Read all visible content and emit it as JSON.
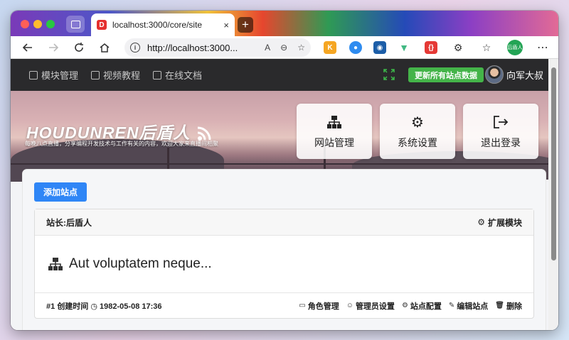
{
  "browser": {
    "tab": {
      "favicon": "D",
      "title": "localhost:3000/core/site",
      "close": "×"
    },
    "new_tab": "+",
    "address": {
      "url": "http://localhost:3000..."
    },
    "profile_label": "后盾人"
  },
  "navbar": {
    "items": [
      {
        "label": "模块管理"
      },
      {
        "label": "视频教程"
      },
      {
        "label": "在线文档"
      }
    ],
    "sync_button": "更新所有站点数据",
    "user_name": "向军大叔"
  },
  "banner": {
    "logo": "HOUDUNREN后盾人",
    "subtitle": "每晚八点直播，分享编程开发技术与工作有关的内容，欢迎大家来直播间相聚",
    "quick_links": [
      {
        "label": "网站管理",
        "icon": "sitemap-icon"
      },
      {
        "label": "系统设置",
        "icon": "gear-icon"
      },
      {
        "label": "退出登录",
        "icon": "logout-icon"
      }
    ]
  },
  "main": {
    "add_button": "添加站点",
    "site": {
      "owner": "站长:后盾人",
      "extend_modules": "扩展模块",
      "name": "Aut voluptatem neque...",
      "id_label": "#1",
      "created_label": "创建时间",
      "created_at": "1982-05-08 17:36",
      "actions": [
        {
          "label": "角色管理",
          "icon": "role-icon"
        },
        {
          "label": "管理员设置",
          "icon": "user-icon"
        },
        {
          "label": "站点配置",
          "icon": "gear-icon"
        },
        {
          "label": "编辑站点",
          "icon": "edit-icon"
        },
        {
          "label": "删除",
          "icon": "trash-icon"
        }
      ]
    }
  },
  "colors": {
    "primary": "#2f86f6",
    "success": "#44b449",
    "navbar": "#2a2a2c"
  }
}
